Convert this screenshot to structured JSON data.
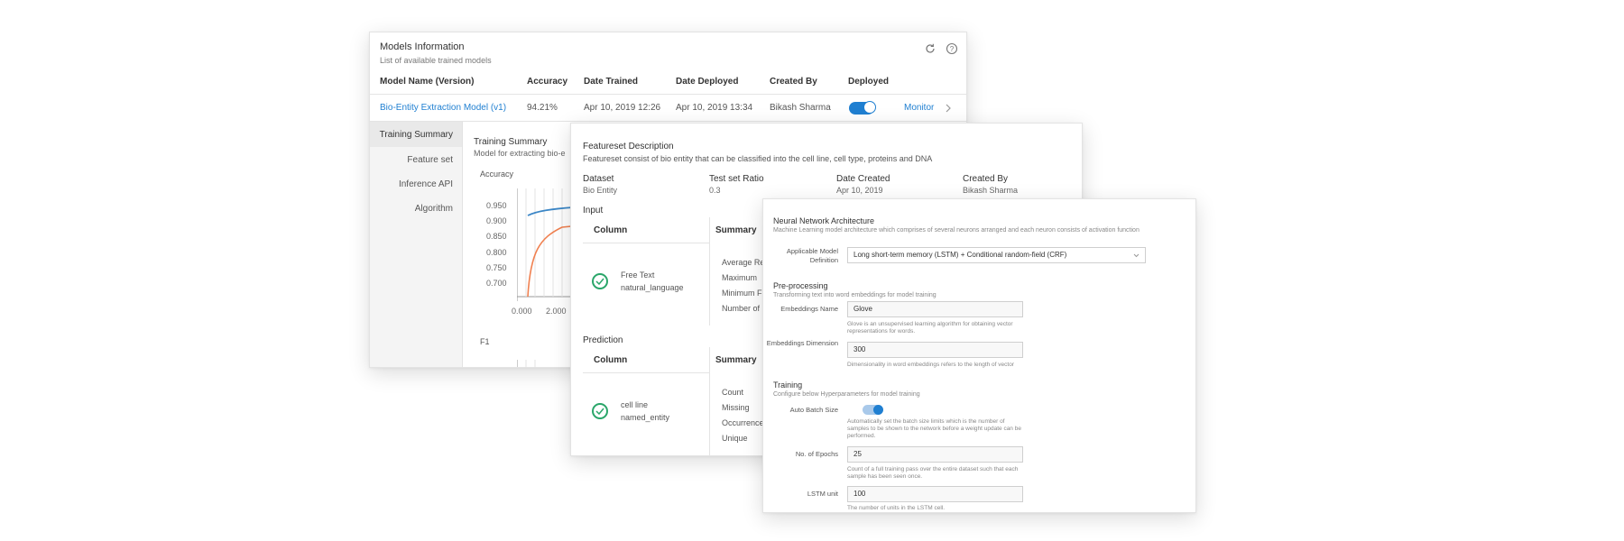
{
  "models": {
    "title": "Models Information",
    "subtitle": "List of available trained models",
    "columns": [
      "Model Name (Version)",
      "Accuracy",
      "Date Trained",
      "Date Deployed",
      "Created By",
      "Deployed"
    ],
    "row": {
      "name": "Bio-Entity Extraction Model (v1)",
      "accuracy": "94.21%",
      "date_trained": "Apr 10, 2019 12:26",
      "date_deployed": "Apr 10, 2019 13:34",
      "created_by": "Bikash Sharma",
      "deployed": true,
      "monitor_label": "Monitor"
    },
    "icons": {
      "refresh": "refresh-icon",
      "help": "help-icon",
      "chevron": "chevron-right-icon"
    },
    "sidebar": [
      "Training Summary",
      "Feature set",
      "Inference API",
      "Algorithm"
    ],
    "summary": {
      "title": "Training Summary",
      "subtitle": "Model for extracting bio-e",
      "accuracy_label": "Accuracy",
      "f1_label": "F1",
      "yticks": [
        "0.950",
        "0.900",
        "0.850",
        "0.800",
        "0.750",
        "0.700"
      ],
      "xticks": [
        "0.000",
        "2.000"
      ]
    }
  },
  "featureset": {
    "title": "Featureset Description",
    "subtitle": "Featureset consist of bio entity that can be classified into the cell line, cell type, proteins and DNA",
    "meta": [
      {
        "label": "Dataset",
        "value": "Bio Entity"
      },
      {
        "label": "Test set Ratio",
        "value": "0.3"
      },
      {
        "label": "Date Created",
        "value": "Apr 10, 2019"
      },
      {
        "label": "Created By",
        "value": "Bikash Sharma"
      }
    ],
    "input": {
      "heading": "Input",
      "col_label": "Column",
      "summary_label": "Summary",
      "column_name": "Free Text",
      "column_type": "natural_language",
      "stats": [
        "Average Re",
        "Maximum",
        "Minimum F",
        "Number of"
      ]
    },
    "prediction": {
      "heading": "Prediction",
      "col_label": "Column",
      "summary_label": "Summary",
      "column_name": "cell line",
      "column_type": "named_entity",
      "stats": [
        "Count",
        "Missing",
        "Occurrence",
        "Unique"
      ]
    }
  },
  "network": {
    "title": "Neural Network Architecture",
    "subtitle": "Machine Learning model architecture which comprises of several neurons arranged and each neuron consists of activation function",
    "model_def_label": "Applicable Model Definition",
    "model_def_value": "Long short-term memory (LSTM) + Conditional random-field (CRF)",
    "preprocessing": {
      "title": "Pre-processing",
      "subtitle": "Transforming text into word embeddings for model training",
      "emb_name_label": "Embeddings Name",
      "emb_name_value": "Glove",
      "emb_name_help": "Glove is an unsupervised learning algorithm for obtaining vector representations for words.",
      "emb_dim_label": "Embeddings Dimension",
      "emb_dim_value": "300",
      "emb_dim_help": "Dimensionality in word embeddings refers to the length of vector"
    },
    "training": {
      "title": "Training",
      "subtitle": "Configure below Hyperparameters for model training",
      "auto_batch_label": "Auto Batch Size",
      "auto_batch_on": true,
      "auto_batch_help": "Automatically set the batch size limits which is the number of samples to be shown to the network before a weight update can be performed.",
      "epochs_label": "No. of Epochs",
      "epochs_value": "25",
      "epochs_help": "Count of a full training pass over the entire dataset such that each sample has been seen once.",
      "lstm_label": "LSTM unit",
      "lstm_value": "100",
      "lstm_help": "The number of units in the LSTM cell."
    }
  }
}
